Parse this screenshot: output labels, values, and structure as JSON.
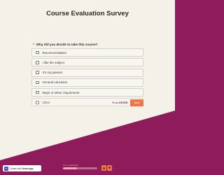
{
  "survey": {
    "title": "Course Evaluation Survey",
    "question": {
      "required_mark": "*",
      "text": "Why did you decide to take this course?"
    },
    "options": [
      "Recommendation",
      "I like the subject",
      "It's my passion",
      "General education",
      "Major or Minor requirement",
      "Other"
    ],
    "press_prefix": "Press",
    "press_key": "ENTER",
    "next_label": "Next"
  },
  "progress": {
    "label": "0 of 1 answered",
    "fraction": 0.4
  },
  "badge": {
    "prefix": "Create with",
    "brand": "forms.app"
  },
  "nav": {
    "up_icon": "chevron-up-icon",
    "down_icon": "chevron-down-icon"
  },
  "colors": {
    "background_light": "#f4f1e8",
    "background_accent": "#8e1c5b",
    "button": "#f0764a"
  }
}
